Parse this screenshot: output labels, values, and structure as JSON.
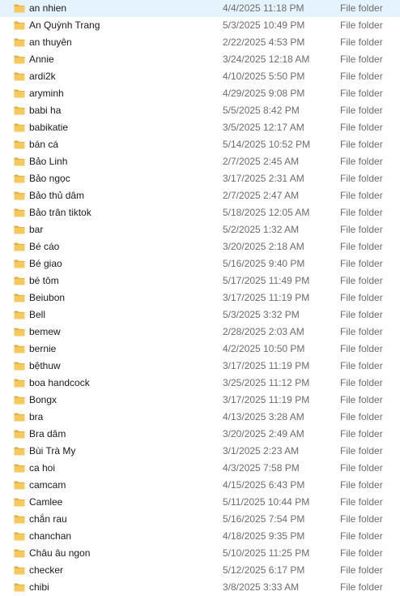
{
  "colors": {
    "folder_body": "#f6c95c",
    "folder_back": "#e6ad3a",
    "muted_text": "#6d6d6d",
    "primary_text": "#1a1a1a"
  },
  "icons": {
    "folder": "folder-icon"
  },
  "files": [
    {
      "name": "an nhien",
      "date": "4/4/2025 11:18 PM",
      "type": "File folder"
    },
    {
      "name": "An Quỳnh Trang",
      "date": "5/3/2025 10:49 PM",
      "type": "File folder"
    },
    {
      "name": "an thuyên",
      "date": "2/22/2025 4:53 PM",
      "type": "File folder"
    },
    {
      "name": "Annie",
      "date": "3/24/2025 12:18 AM",
      "type": "File folder"
    },
    {
      "name": "ardi2k",
      "date": "4/10/2025 5:50 PM",
      "type": "File folder"
    },
    {
      "name": "aryminh",
      "date": "4/29/2025 9:08 PM",
      "type": "File folder"
    },
    {
      "name": "babi ha",
      "date": "5/5/2025 8:42 PM",
      "type": "File folder"
    },
    {
      "name": "babikatie",
      "date": "3/5/2025 12:17 AM",
      "type": "File folder"
    },
    {
      "name": "bán cá",
      "date": "5/14/2025 10:52 PM",
      "type": "File folder"
    },
    {
      "name": "Bảo Linh",
      "date": "2/7/2025 2:45 AM",
      "type": "File folder"
    },
    {
      "name": "Bảo ngọc",
      "date": "3/17/2025 2:31 AM",
      "type": "File folder"
    },
    {
      "name": "Bảo thủ dâm",
      "date": "2/7/2025 2:47 AM",
      "type": "File folder"
    },
    {
      "name": "Bảo trân tiktok",
      "date": "5/18/2025 12:05 AM",
      "type": "File folder"
    },
    {
      "name": "bar",
      "date": "5/2/2025 1:32 AM",
      "type": "File folder"
    },
    {
      "name": "Bé cáo",
      "date": "3/20/2025 2:18 AM",
      "type": "File folder"
    },
    {
      "name": "Bé giao",
      "date": "5/16/2025 9:40 PM",
      "type": "File folder"
    },
    {
      "name": "bé tôm",
      "date": "5/17/2025 11:49 PM",
      "type": "File folder"
    },
    {
      "name": "Beiubon",
      "date": "3/17/2025 11:19 PM",
      "type": "File folder"
    },
    {
      "name": "Bell",
      "date": "5/3/2025 3:32 PM",
      "type": "File folder"
    },
    {
      "name": "bemew",
      "date": "2/28/2025 2:03 AM",
      "type": "File folder"
    },
    {
      "name": "bernie",
      "date": "4/2/2025 10:50 PM",
      "type": "File folder"
    },
    {
      "name": "bệthuw",
      "date": "3/17/2025 11:19 PM",
      "type": "File folder"
    },
    {
      "name": "boa handcock",
      "date": "3/25/2025 11:12 PM",
      "type": "File folder"
    },
    {
      "name": "Bongx",
      "date": "3/17/2025 11:19 PM",
      "type": "File folder"
    },
    {
      "name": "bra",
      "date": "4/13/2025 3:28 AM",
      "type": "File folder"
    },
    {
      "name": "Bra dâm",
      "date": "3/20/2025 2:49 AM",
      "type": "File folder"
    },
    {
      "name": "Bùi Trà My",
      "date": "3/1/2025 2:23 AM",
      "type": "File folder"
    },
    {
      "name": "ca hoi",
      "date": "4/3/2025 7:58 PM",
      "type": "File folder"
    },
    {
      "name": "camcam",
      "date": "4/15/2025 6:43 PM",
      "type": "File folder"
    },
    {
      "name": "Camlee",
      "date": "5/11/2025 10:44 PM",
      "type": "File folder"
    },
    {
      "name": "chắn rau",
      "date": "5/16/2025 7:54 PM",
      "type": "File folder"
    },
    {
      "name": "chanchan",
      "date": "4/18/2025 9:35 PM",
      "type": "File folder"
    },
    {
      "name": "Châu âu ngon",
      "date": "5/10/2025 11:25 PM",
      "type": "File folder"
    },
    {
      "name": "checker",
      "date": "5/12/2025 6:17 PM",
      "type": "File folder"
    },
    {
      "name": "chibi",
      "date": "3/8/2025 3:33 AM",
      "type": "File folder"
    }
  ]
}
